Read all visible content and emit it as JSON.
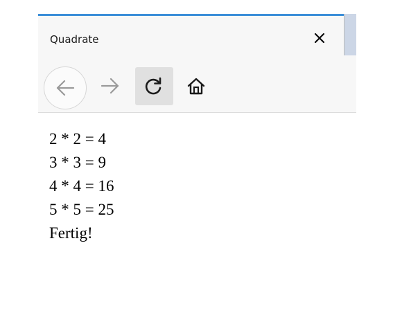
{
  "tab": {
    "title": "Quadrate",
    "close_icon": "close-icon"
  },
  "toolbar": {
    "back_icon": "arrow-left-icon",
    "forward_icon": "arrow-right-icon",
    "reload_icon": "reload-icon",
    "home_icon": "home-icon"
  },
  "colors": {
    "tab_accent": "#3b8ed8",
    "toolbar_bg": "#f7f7f7",
    "reload_hover_bg": "#e0e0e0"
  },
  "content": {
    "lines": [
      "2 * 2 = 4",
      "3 * 3 = 9",
      "4 * 4 = 16",
      "5 * 5 = 25",
      "Fertig!"
    ]
  }
}
